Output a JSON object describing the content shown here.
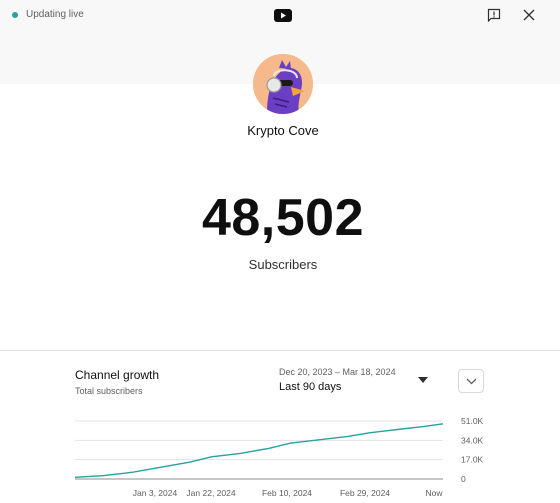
{
  "header": {
    "live_status": "Updating live",
    "logo_icon": "youtube-icon",
    "feedback_icon": "feedback-icon",
    "close_icon": "close-icon",
    "accent_color": "#26a3a0"
  },
  "channel": {
    "name": "Krypto Cove",
    "avatar_icon": "channel-avatar"
  },
  "subscribers": {
    "count": "48,502",
    "label": "Subscribers"
  },
  "growth": {
    "title": "Channel growth",
    "subtitle": "Total subscribers",
    "date_range": "Dec 20, 2023 – Mar 18, 2024",
    "range_label": "Last 90 days",
    "dropdown_icon": "caret-down-icon",
    "expand_icon": "chevron-down-icon"
  },
  "chart_data": {
    "type": "line",
    "title": "",
    "xlabel": "",
    "ylabel": "",
    "x_tick_labels": [
      "Jan 3, 2024",
      "Jan 22, 2024",
      "Feb 10, 2024",
      "Feb 29, 2024",
      "Now"
    ],
    "y_tick_labels": [
      "51.0K",
      "34.0K",
      "17.0K",
      "0"
    ],
    "ylim": [
      0,
      51000
    ],
    "grid": true,
    "line_color": "#26a3a0",
    "series": [
      {
        "x": [
          "2023-12-20",
          "2023-12-27",
          "2024-01-03",
          "2024-01-10",
          "2024-01-17",
          "2024-01-22",
          "2024-01-29",
          "2024-02-05",
          "2024-02-10",
          "2024-02-17",
          "2024-02-24",
          "2024-02-29",
          "2024-03-07",
          "2024-03-13",
          "2024-03-18"
        ],
        "y": [
          1500,
          3000,
          6000,
          10500,
          15000,
          19500,
          22500,
          27000,
          31500,
          34500,
          37500,
          40500,
          43500,
          46000,
          48502
        ]
      }
    ]
  }
}
